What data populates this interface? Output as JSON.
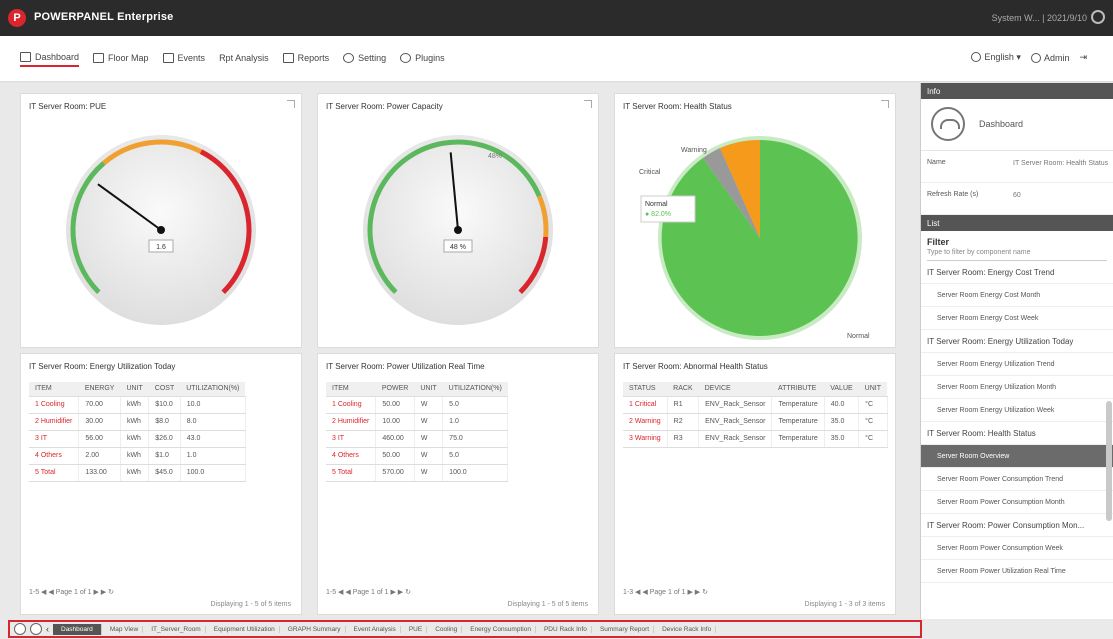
{
  "app": {
    "title": "POWERPANEL Enterprise",
    "user_text": "System W... | 2021/9/10"
  },
  "nav": {
    "tabs": [
      "Dashboard",
      "Floor Map",
      "Events",
      "Rpt Analysis",
      "Reports",
      "Setting",
      "Plugins"
    ],
    "language": "English",
    "admin": "Admin"
  },
  "panels": {
    "gauge1": {
      "title": "IT Server Room: PUE",
      "value": 1.6,
      "min": 1,
      "max": 3,
      "readout": "1.6",
      "colors": {
        "good": "#5cb85c",
        "warn": "#f0a030",
        "bad": "#d9262e"
      }
    },
    "gauge2": {
      "title": "IT Server Room: Power Capacity",
      "value": 48,
      "min": 0,
      "max": 100,
      "readout": "48 %",
      "top_label": "48%"
    },
    "pie": {
      "title": "IT Server Room: Health Status",
      "labels": {
        "warning": "Warning",
        "critical": "Critical",
        "normal": "Normal"
      },
      "tooltip": {
        "title": "Normal",
        "value": "● 82.0%"
      }
    },
    "energy": {
      "title": "IT Server Room: Energy Utilization Today",
      "headers": [
        "ITEM",
        "ENERGY",
        "UNIT",
        "COST",
        "UTILIZATION(%)"
      ],
      "rows": [
        [
          "1",
          "Cooling",
          "70.00",
          "kWh",
          "$10.0",
          "10.0"
        ],
        [
          "2",
          "Humidifier",
          "30.00",
          "kWh",
          "$8.0",
          "8.0"
        ],
        [
          "3",
          "IT",
          "56.00",
          "kWh",
          "$26.0",
          "43.0"
        ],
        [
          "4",
          "Others",
          "2.00",
          "kWh",
          "$1.0",
          "1.0"
        ],
        [
          "5",
          "Total",
          "133.00",
          "kWh",
          "$45.0",
          "100.0"
        ]
      ],
      "pager": "1-5 ◀ ◀ Page 1 of 1 ▶ ▶ ↻",
      "info": "Displaying 1 - 5 of 5 items"
    },
    "power": {
      "title": "IT Server Room: Power Utilization Real Time",
      "headers": [
        "ITEM",
        "POWER",
        "UNIT",
        "UTILIZATION(%)"
      ],
      "rows": [
        [
          "1",
          "Cooling",
          "50.00",
          "W",
          "5.0"
        ],
        [
          "2",
          "Humidifier",
          "10.00",
          "W",
          "1.0"
        ],
        [
          "3",
          "IT",
          "460.00",
          "W",
          "75.0"
        ],
        [
          "4",
          "Others",
          "50.00",
          "W",
          "5.0"
        ],
        [
          "5",
          "Total",
          "570.00",
          "W",
          "100.0"
        ]
      ],
      "pager": "1-5 ◀ ◀ Page 1 of 1 ▶ ▶ ↻",
      "info": "Displaying 1 - 5 of 5 items"
    },
    "abnormal": {
      "title": "IT Server Room: Abnormal Health Status",
      "headers": [
        "STATUS",
        "RACK",
        "DEVICE",
        "ATTRIBUTE",
        "VALUE",
        "UNIT"
      ],
      "rows": [
        [
          "1",
          "Critical",
          "R1",
          "ENV_Rack_Sensor",
          "Temperature",
          "40.0",
          "°C"
        ],
        [
          "2",
          "Warning",
          "R2",
          "ENV_Rack_Sensor",
          "Temperature",
          "35.0",
          "°C"
        ],
        [
          "3",
          "Warning",
          "R3",
          "ENV_Rack_Sensor",
          "Temperature",
          "35.0",
          "°C"
        ]
      ],
      "pager": "1-3 ◀ ◀ Page 1 of 1 ▶ ▶ ↻",
      "info": "Displaying 1 - 3 of 3 items"
    }
  },
  "sidebar": {
    "info_head": "Info",
    "dashboard_label": "Dashboard",
    "props": [
      {
        "key": "Name",
        "val": "IT Server Room: Health Status"
      },
      {
        "key": "Refresh Rate (s)",
        "val": "60"
      }
    ],
    "list_head": "List",
    "filter_label": "Filter",
    "filter_placeholder": "Type to filter by component name",
    "items": [
      {
        "text": "IT Server Room: Energy Cost Trend",
        "kind": "group"
      },
      {
        "text": "Server Room Energy Cost Month",
        "kind": "item"
      },
      {
        "text": "Server Room Energy Cost Week",
        "kind": "item"
      },
      {
        "text": "IT Server Room: Energy Utilization Today",
        "kind": "group"
      },
      {
        "text": "Server Room Energy Utilization Trend",
        "kind": "item"
      },
      {
        "text": "Server Room Energy Utilization Month",
        "kind": "item"
      },
      {
        "text": "Server Room Energy Utilization Week",
        "kind": "item"
      },
      {
        "text": "IT Server Room: Health Status",
        "kind": "group"
      },
      {
        "text": "Server Room Overview",
        "kind": "selected"
      },
      {
        "text": "Server Room Power Consumption Trend",
        "kind": "item"
      },
      {
        "text": "Server Room Power Consumption Month",
        "kind": "item"
      },
      {
        "text": "IT Server Room: Power Consumption Mon...",
        "kind": "group"
      },
      {
        "text": "Server Room Power Consumption Week",
        "kind": "item"
      },
      {
        "text": "Server Room Power Utilization Real Time",
        "kind": "item"
      }
    ]
  },
  "footer": {
    "tabs": [
      "Dashboard",
      "Map View",
      "IT_Server_Room",
      "Equipment Utilization",
      "GRAPH Summary",
      "Event Analysis",
      "PUE",
      "Cooling",
      "Energy Consumption",
      "PDU Rack Info",
      "Summary Report",
      "Device Rack Info"
    ]
  }
}
